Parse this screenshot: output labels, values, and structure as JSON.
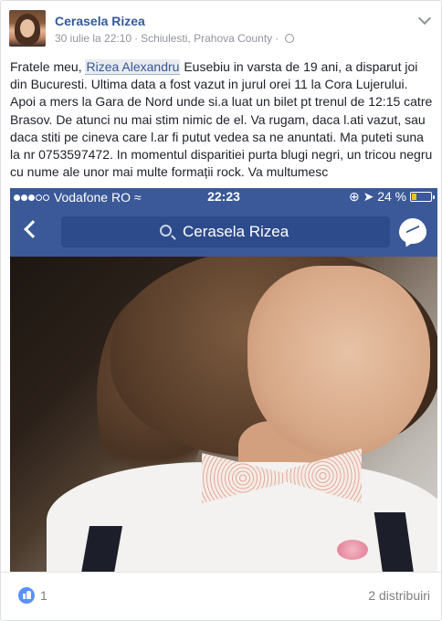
{
  "post": {
    "author": "Cerasela Rizea",
    "date": "30 iulie la 22:10",
    "separator": "·",
    "location": "Schiulesti, Prahova County",
    "separator2": "·",
    "text_before_mention": "Fratele meu, ",
    "mention": "Rizea Alexandru",
    "text_after_mention": " Eusebiu in varsta de 19 ani, a disparut joi din Bucuresti. Ultima data a fost vazut in jurul orei 11 la Cora Lujerului. Apoi a mers la Gara de Nord unde si.a luat un bilet pt trenul de 12:15 catre Brasov. De atunci nu mai stim nimic de el. Va rugam, daca l.ati vazut, sau daca stiti pe cineva care l.ar fi putut vedea sa ne anuntati. Ma puteti suna la nr 0753597472. In momentul disparitiei purta blugi negri, un tricou negru cu nume ale unor mai multe formații rock. Va multumesc"
  },
  "screenshot": {
    "carrier": "Vodafone RO",
    "time": "22:23",
    "battery": "24 %",
    "search_label": "Cerasela Rizea"
  },
  "footer": {
    "like_count": "1",
    "shares": "2 distribuiri"
  },
  "colors": {
    "facebook_blue": "#3b5998",
    "link_blue": "#365899",
    "like_blue": "#5890ff"
  },
  "icons": [
    "globe-icon",
    "chevron-down-icon",
    "signal-icon",
    "wifi-icon",
    "location-icon",
    "battery-icon",
    "back-icon",
    "search-icon",
    "messenger-icon",
    "like-icon"
  ]
}
